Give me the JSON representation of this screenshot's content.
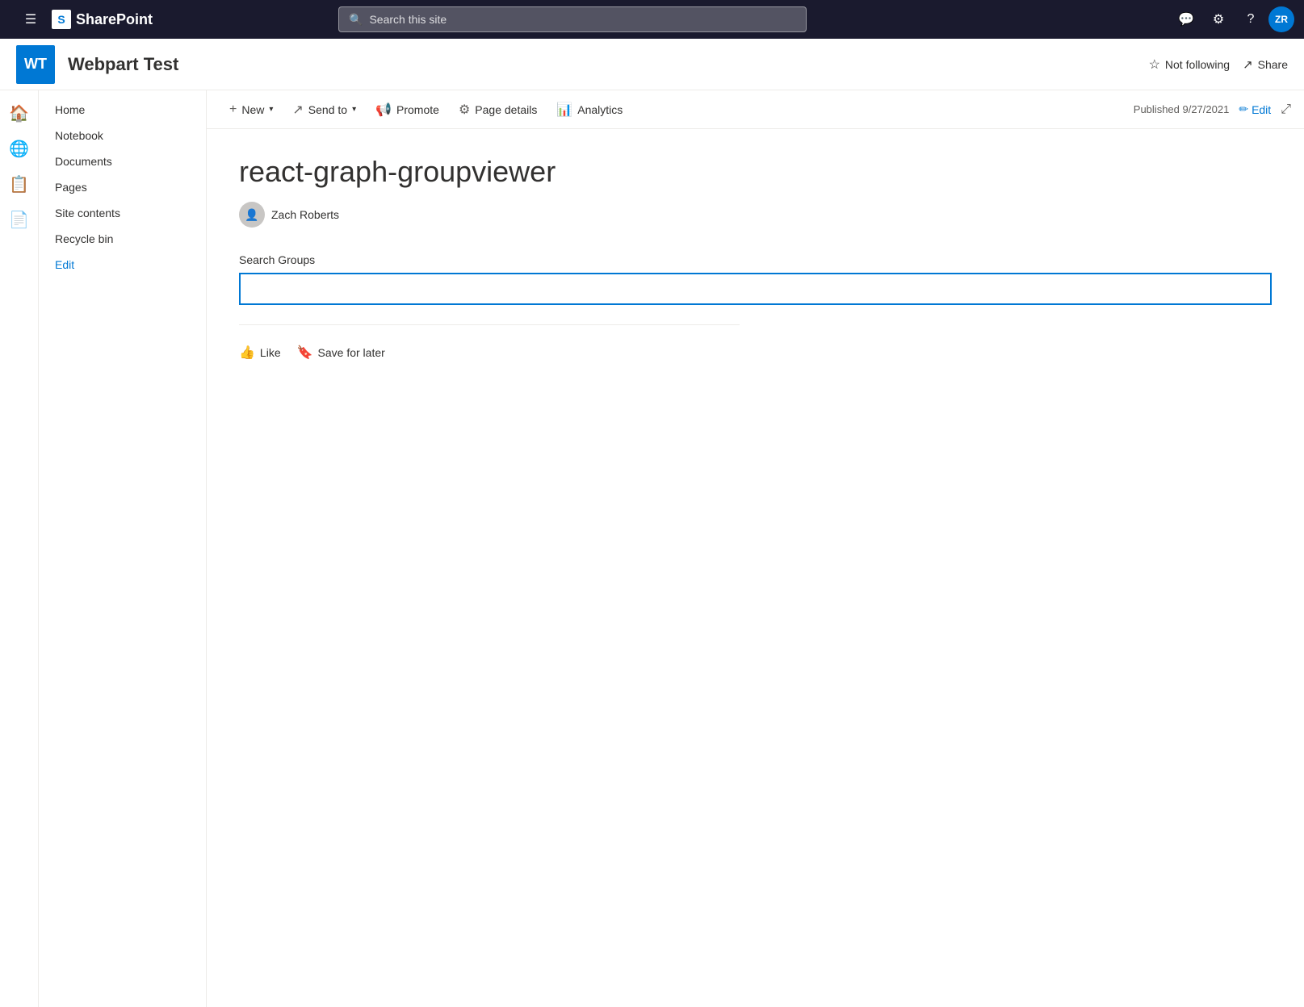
{
  "topnav": {
    "app_icon": "≡",
    "brand": "SharePoint",
    "search_placeholder": "Search this site",
    "chat_icon": "💬",
    "settings_icon": "⚙",
    "help_icon": "?",
    "user_initials": "ZR"
  },
  "site_header": {
    "logo_text": "WT",
    "title": "Webpart Test",
    "not_following_label": "Not following",
    "share_label": "Share"
  },
  "left_nav": {
    "items": [
      {
        "label": "Home",
        "active": false
      },
      {
        "label": "Notebook",
        "active": false
      },
      {
        "label": "Documents",
        "active": false
      },
      {
        "label": "Pages",
        "active": false
      },
      {
        "label": "Site contents",
        "active": false
      },
      {
        "label": "Recycle bin",
        "active": false
      },
      {
        "label": "Edit",
        "active": false,
        "is_edit": true
      }
    ]
  },
  "command_bar": {
    "new_label": "New",
    "send_to_label": "Send to",
    "promote_label": "Promote",
    "page_details_label": "Page details",
    "analytics_label": "Analytics",
    "published_text": "Published 9/27/2021",
    "edit_label": "Edit"
  },
  "page": {
    "title": "react-graph-groupviewer",
    "author_name": "Zach Roberts",
    "search_groups_label": "Search Groups",
    "search_groups_placeholder": "",
    "like_label": "Like",
    "save_for_later_label": "Save for later"
  }
}
